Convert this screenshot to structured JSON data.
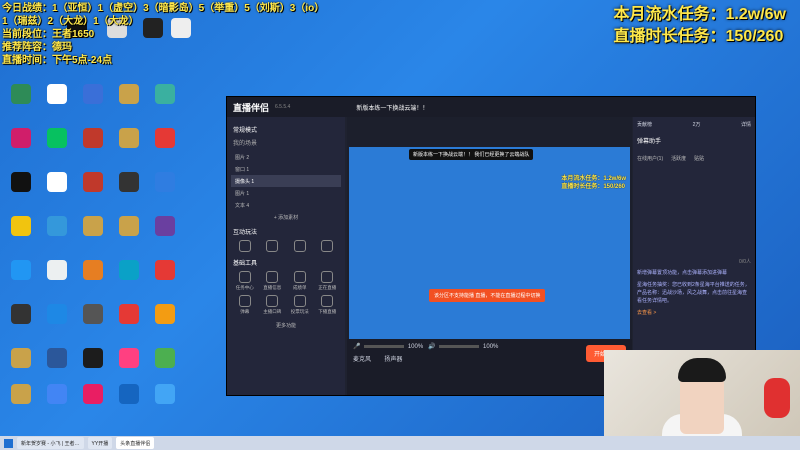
{
  "overlay_left": {
    "lines": [
      "今日战绩：1（亚恒）1（虚空）3（暗影岛）5（举重）5（刘斯）3（io）",
      "1（瑞兹）2（大龙）1（大龙）",
      "当前段位：王者1650",
      "推荐阵容：德玛",
      "直播时间：下午5点-24点"
    ]
  },
  "overlay_right": {
    "line1_label": "本月流水任务：",
    "line1_value": "1.2w/6w",
    "line2_label": "直播时长任务：",
    "line2_value": "150/260"
  },
  "app": {
    "title": "直播伴侣",
    "version": "6.5.5.4",
    "stream_title": "新版本练一下换战云端！！",
    "start_button": "开始直播",
    "left": {
      "mode": "常规模式",
      "scenes_title": "我的场景",
      "scenes": [
        "图片 2",
        "窗口 1",
        "摄像头 1",
        "图片 1",
        "文本 4"
      ],
      "add_material": "+ 添加素材",
      "interactive_title": "互动玩法",
      "basic_tools_title": "基础工具",
      "tools": [
        "任务中心",
        "直播信息",
        "成绩单",
        "正在直播",
        "弹幕",
        "主播口碑",
        "投票玩法",
        "下播直播"
      ],
      "more": "更多功能"
    },
    "preview": {
      "banner": "新版本练一下换战云端！！ 我们已经更换了云端战队",
      "alert": "该分区不支持能播 直播，不能在直播过程中切换",
      "overlay_line1": "本月流水任务：1.2w/6w",
      "overlay_line2": "直播时长任务：150/260"
    },
    "audio": {
      "mic_label": "麦克风",
      "speaker_label": "扬声器",
      "mic_volume": "100%",
      "speaker_volume": "100%"
    },
    "right": {
      "tab_contrib": "贡献榜",
      "tab_count": "2万",
      "details": "详情",
      "assistant_title": "弹幕助手",
      "tabs": [
        "在线用户(1)",
        "活跃度",
        "贴贴"
      ],
      "notice1": "新增弹幕置顶功能，点击弹幕添加进弹幕",
      "notice2": "星海任务抽奖：您已收到2条星海平台推送的任务，产品名称：迅战沙场，风之战舞，点击前往星海查看任务详情吧。",
      "notice_action": "去查看 >",
      "counter": "0/0人"
    }
  },
  "taskbar": {
    "items": [
      "新年贺岁赛 - 小飞 | 王者…",
      "YY开播",
      "头条直播伴侣"
    ]
  }
}
